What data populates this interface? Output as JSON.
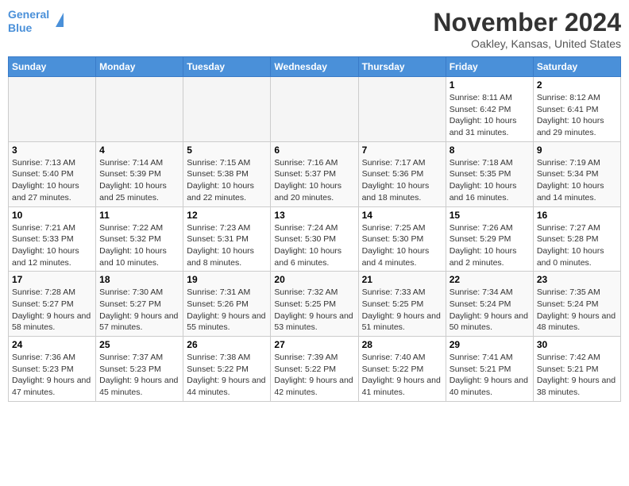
{
  "header": {
    "logo_line1": "General",
    "logo_line2": "Blue",
    "month_title": "November 2024",
    "location": "Oakley, Kansas, United States"
  },
  "days_of_week": [
    "Sunday",
    "Monday",
    "Tuesday",
    "Wednesday",
    "Thursday",
    "Friday",
    "Saturday"
  ],
  "weeks": [
    [
      {
        "day": "",
        "info": ""
      },
      {
        "day": "",
        "info": ""
      },
      {
        "day": "",
        "info": ""
      },
      {
        "day": "",
        "info": ""
      },
      {
        "day": "",
        "info": ""
      },
      {
        "day": "1",
        "info": "Sunrise: 8:11 AM\nSunset: 6:42 PM\nDaylight: 10 hours and 31 minutes."
      },
      {
        "day": "2",
        "info": "Sunrise: 8:12 AM\nSunset: 6:41 PM\nDaylight: 10 hours and 29 minutes."
      }
    ],
    [
      {
        "day": "3",
        "info": "Sunrise: 7:13 AM\nSunset: 5:40 PM\nDaylight: 10 hours and 27 minutes."
      },
      {
        "day": "4",
        "info": "Sunrise: 7:14 AM\nSunset: 5:39 PM\nDaylight: 10 hours and 25 minutes."
      },
      {
        "day": "5",
        "info": "Sunrise: 7:15 AM\nSunset: 5:38 PM\nDaylight: 10 hours and 22 minutes."
      },
      {
        "day": "6",
        "info": "Sunrise: 7:16 AM\nSunset: 5:37 PM\nDaylight: 10 hours and 20 minutes."
      },
      {
        "day": "7",
        "info": "Sunrise: 7:17 AM\nSunset: 5:36 PM\nDaylight: 10 hours and 18 minutes."
      },
      {
        "day": "8",
        "info": "Sunrise: 7:18 AM\nSunset: 5:35 PM\nDaylight: 10 hours and 16 minutes."
      },
      {
        "day": "9",
        "info": "Sunrise: 7:19 AM\nSunset: 5:34 PM\nDaylight: 10 hours and 14 minutes."
      }
    ],
    [
      {
        "day": "10",
        "info": "Sunrise: 7:21 AM\nSunset: 5:33 PM\nDaylight: 10 hours and 12 minutes."
      },
      {
        "day": "11",
        "info": "Sunrise: 7:22 AM\nSunset: 5:32 PM\nDaylight: 10 hours and 10 minutes."
      },
      {
        "day": "12",
        "info": "Sunrise: 7:23 AM\nSunset: 5:31 PM\nDaylight: 10 hours and 8 minutes."
      },
      {
        "day": "13",
        "info": "Sunrise: 7:24 AM\nSunset: 5:30 PM\nDaylight: 10 hours and 6 minutes."
      },
      {
        "day": "14",
        "info": "Sunrise: 7:25 AM\nSunset: 5:30 PM\nDaylight: 10 hours and 4 minutes."
      },
      {
        "day": "15",
        "info": "Sunrise: 7:26 AM\nSunset: 5:29 PM\nDaylight: 10 hours and 2 minutes."
      },
      {
        "day": "16",
        "info": "Sunrise: 7:27 AM\nSunset: 5:28 PM\nDaylight: 10 hours and 0 minutes."
      }
    ],
    [
      {
        "day": "17",
        "info": "Sunrise: 7:28 AM\nSunset: 5:27 PM\nDaylight: 9 hours and 58 minutes."
      },
      {
        "day": "18",
        "info": "Sunrise: 7:30 AM\nSunset: 5:27 PM\nDaylight: 9 hours and 57 minutes."
      },
      {
        "day": "19",
        "info": "Sunrise: 7:31 AM\nSunset: 5:26 PM\nDaylight: 9 hours and 55 minutes."
      },
      {
        "day": "20",
        "info": "Sunrise: 7:32 AM\nSunset: 5:25 PM\nDaylight: 9 hours and 53 minutes."
      },
      {
        "day": "21",
        "info": "Sunrise: 7:33 AM\nSunset: 5:25 PM\nDaylight: 9 hours and 51 minutes."
      },
      {
        "day": "22",
        "info": "Sunrise: 7:34 AM\nSunset: 5:24 PM\nDaylight: 9 hours and 50 minutes."
      },
      {
        "day": "23",
        "info": "Sunrise: 7:35 AM\nSunset: 5:24 PM\nDaylight: 9 hours and 48 minutes."
      }
    ],
    [
      {
        "day": "24",
        "info": "Sunrise: 7:36 AM\nSunset: 5:23 PM\nDaylight: 9 hours and 47 minutes."
      },
      {
        "day": "25",
        "info": "Sunrise: 7:37 AM\nSunset: 5:23 PM\nDaylight: 9 hours and 45 minutes."
      },
      {
        "day": "26",
        "info": "Sunrise: 7:38 AM\nSunset: 5:22 PM\nDaylight: 9 hours and 44 minutes."
      },
      {
        "day": "27",
        "info": "Sunrise: 7:39 AM\nSunset: 5:22 PM\nDaylight: 9 hours and 42 minutes."
      },
      {
        "day": "28",
        "info": "Sunrise: 7:40 AM\nSunset: 5:22 PM\nDaylight: 9 hours and 41 minutes."
      },
      {
        "day": "29",
        "info": "Sunrise: 7:41 AM\nSunset: 5:21 PM\nDaylight: 9 hours and 40 minutes."
      },
      {
        "day": "30",
        "info": "Sunrise: 7:42 AM\nSunset: 5:21 PM\nDaylight: 9 hours and 38 minutes."
      }
    ]
  ]
}
